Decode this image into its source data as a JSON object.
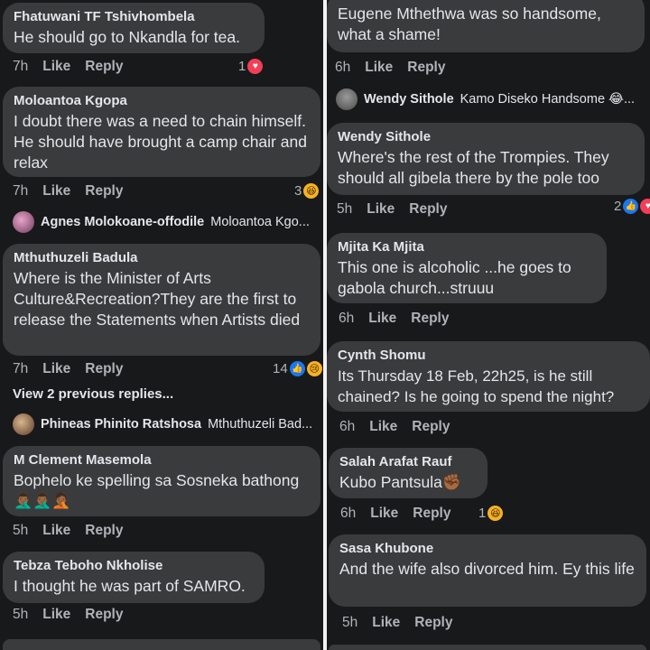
{
  "left": {
    "comments": [
      {
        "author": "Fhatuwani TF Tshivhombela",
        "text": "He should go to Nkandla for tea.",
        "time": "7h",
        "like": "Like",
        "reply": "Reply",
        "reaction_count": "1",
        "reaction": "heart-reaction-icon"
      },
      {
        "author": "Moloantoa Kgopa",
        "text": "I doubt there was a need to chain himself. He should have brought a camp chair and relax",
        "time": "7h",
        "like": "Like",
        "reply": "Reply",
        "reaction_count": "3",
        "reaction": "haha-reaction-icon"
      },
      {
        "author": "Mthuthuzeli Badula",
        "text": "Where is the Minister of Arts Culture&Recreation?They are the first to release the Statements when Artists died",
        "time": "7h",
        "like": "Like",
        "reply": "Reply",
        "reaction_count": "14",
        "reaction": "like-sad-reaction-icon"
      },
      {
        "author": "M Clement Masemola",
        "text": "Bophelo ke spelling sa Sosneka bathong",
        "emojis": "🤦🏾‍♂️🤦🏾‍♂️🤦🏾",
        "time": "5h",
        "like": "Like",
        "reply": "Reply"
      },
      {
        "author": "Tebza Teboho Nkholise",
        "text": "I thought he was part of SAMRO.",
        "time": "5h",
        "like": "Like",
        "reply": "Reply"
      }
    ],
    "reply_previews": [
      {
        "name": "Agnes Molokoane-offodile",
        "tag": "Moloantoa Kgo..."
      },
      {
        "name": "Phineas Phinito Ratshosa",
        "tag": "Mthuthuzeli Bad..."
      }
    ],
    "view_previous": "View 2 previous replies..."
  },
  "right": {
    "comments": [
      {
        "text": "Eugene Mthethwa was so handsome, what a shame!",
        "time": "6h",
        "like": "Like",
        "reply": "Reply"
      },
      {
        "author": "Wendy Sithole",
        "text": "Where's the rest of the Trompies. They should all gibela there by the pole too",
        "time": "5h",
        "like": "Like",
        "reply": "Reply",
        "reaction_count": "2",
        "reaction": "like-heart-reaction-icon"
      },
      {
        "author": "Mjita Ka Mjita",
        "text": "This one is alcoholic ...he goes to gabola church...struuu",
        "time": "6h",
        "like": "Like",
        "reply": "Reply"
      },
      {
        "author": "Cynth Shomu",
        "text": "Its Thursday 18 Feb, 22h25, is he still chained? Is he going to spend the night?",
        "time": "6h",
        "like": "Like",
        "reply": "Reply"
      },
      {
        "author": "Salah Arafat Rauf",
        "text": "Kubo Pantsula✊🏾",
        "time": "6h",
        "like": "Like",
        "reply": "Reply",
        "reaction_count": "1",
        "reaction": "haha-reaction-icon"
      },
      {
        "author": "Sasa Khubone",
        "text": "And the wife also divorced him. Ey this life",
        "time": "5h",
        "like": "Like",
        "reply": "Reply"
      }
    ],
    "reply_previews": [
      {
        "name": "Wendy Sithole",
        "tag": "Kamo Diseko Handsome 😂..."
      }
    ]
  },
  "colors": {
    "background": "#18191a",
    "bubble": "#3a3b3c",
    "text": "#e4e6eb",
    "muted": "#b0b3b8",
    "like_blue": "#1877f2",
    "heart_red": "#f33e58",
    "emoji_yellow": "#f7b125"
  }
}
